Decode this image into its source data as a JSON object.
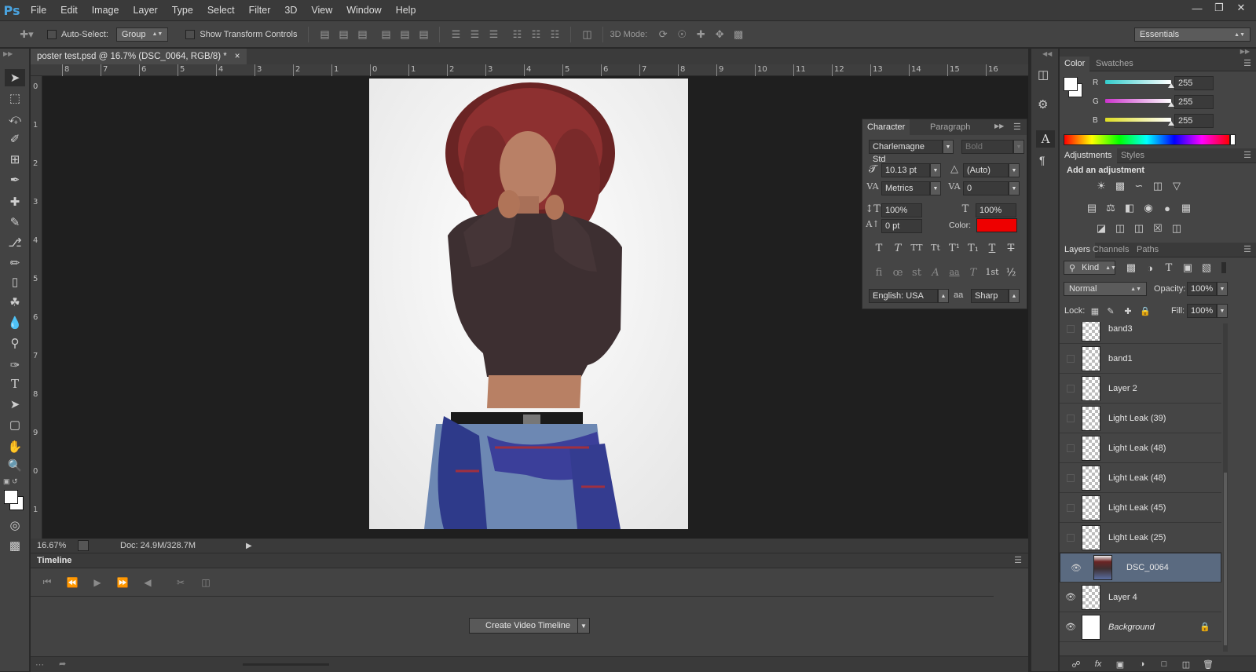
{
  "app": {
    "logo": "Ps"
  },
  "menu": [
    "File",
    "Edit",
    "Image",
    "Layer",
    "Type",
    "Select",
    "Filter",
    "3D",
    "View",
    "Window",
    "Help"
  ],
  "window_controls": [
    "minimize-icon",
    "restore-icon",
    "close-icon"
  ],
  "options": {
    "auto_select_label": "Auto-Select:",
    "auto_select_value": "Group",
    "show_transform_label": "Show Transform Controls",
    "mode3d_label": "3D Mode:",
    "workspace": "Essentials"
  },
  "document": {
    "tab_title": "poster test.psd @ 16.7% (DSC_0064, RGB/8) *",
    "zoom": "16.67%",
    "doc_size": "Doc: 24.9M/328.7M",
    "ruler_h": [
      "8",
      "7",
      "6",
      "5",
      "4",
      "3",
      "2",
      "1",
      "0",
      "1",
      "2",
      "3",
      "4",
      "5",
      "6",
      "7",
      "8",
      "9",
      "10",
      "11",
      "12",
      "13",
      "14",
      "15",
      "16"
    ],
    "ruler_v": [
      "0",
      "1",
      "2",
      "3",
      "4",
      "5",
      "6",
      "7",
      "8",
      "9",
      "0",
      "1"
    ]
  },
  "timeline": {
    "title": "Timeline",
    "create_button": "Create Video Timeline"
  },
  "character": {
    "tab_character": "Character",
    "tab_paragraph": "Paragraph",
    "font_family": "Charlemagne Std",
    "font_style": "Bold",
    "font_size": "10.13 pt",
    "leading": "(Auto)",
    "kerning": "Metrics",
    "tracking": "0",
    "vscale": "100%",
    "hscale": "100%",
    "baseline": "0 pt",
    "color_label": "Color:",
    "color": "#ee0000",
    "language": "English: USA",
    "antialias": "Sharp",
    "aa_label": "aa"
  },
  "color_panel": {
    "tab_color": "Color",
    "tab_swatches": "Swatches",
    "channels": [
      {
        "label": "R",
        "value": "255",
        "color": "#33cccc"
      },
      {
        "label": "G",
        "value": "255",
        "color": "#cc33cc"
      },
      {
        "label": "B",
        "value": "255",
        "color": "#dddd22"
      }
    ]
  },
  "adjustments": {
    "tab_adjustments": "Adjustments",
    "tab_styles": "Styles",
    "heading": "Add an adjustment"
  },
  "layers_panel": {
    "tab_layers": "Layers",
    "tab_channels": "Channels",
    "tab_paths": "Paths",
    "filter_kind": "Kind",
    "blend_mode": "Normal",
    "opacity_label": "Opacity:",
    "opacity": "100%",
    "lock_label": "Lock:",
    "fill_label": "Fill:",
    "fill": "100%",
    "layers": [
      {
        "name": "band3",
        "visible": false
      },
      {
        "name": "band1",
        "visible": false
      },
      {
        "name": "Layer 2",
        "visible": false
      },
      {
        "name": "Light Leak (39)",
        "visible": false
      },
      {
        "name": "Light Leak (48)",
        "visible": false
      },
      {
        "name": "Light Leak (48)",
        "visible": false
      },
      {
        "name": "Light Leak (45)",
        "visible": false
      },
      {
        "name": "Light Leak (25)",
        "visible": false
      },
      {
        "name": "DSC_0064",
        "visible": true,
        "selected": true
      },
      {
        "name": "Layer 4",
        "visible": true
      },
      {
        "name": "Background",
        "visible": true,
        "locked": true
      }
    ]
  }
}
